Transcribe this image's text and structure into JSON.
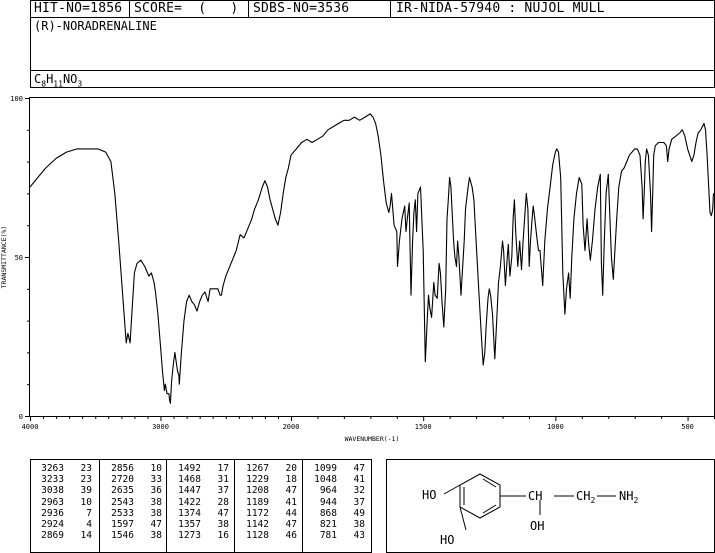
{
  "header": {
    "hit_no": "HIT-NO=1856",
    "score": "SCORE=  (   )",
    "sdbs_no": "SDBS-NO=3536",
    "ir_no": "IR-NIDA-57940 : NUJOL MULL"
  },
  "compound": {
    "name": "(R)-NORADRENALINE",
    "formula": "C8H11NO3"
  },
  "chart_data": {
    "type": "line",
    "xlabel": "WAVENUMBER(-1)",
    "ylabel": "TRANSMITTANCE(%)",
    "xlim": [
      4000,
      400
    ],
    "ylim": [
      0,
      100
    ],
    "x_ticks": [
      "4000",
      "3000",
      "2000",
      "1500",
      "1000",
      "500"
    ],
    "y_ticks": [
      "0",
      "50",
      "100"
    ],
    "grid": false,
    "series": [
      {
        "points": [
          [
            4000,
            72
          ],
          [
            3940,
            75
          ],
          [
            3880,
            78
          ],
          [
            3800,
            81
          ],
          [
            3720,
            83
          ],
          [
            3640,
            84
          ],
          [
            3560,
            84
          ],
          [
            3480,
            84
          ],
          [
            3420,
            83
          ],
          [
            3380,
            80
          ],
          [
            3350,
            70
          ],
          [
            3320,
            55
          ],
          [
            3290,
            38
          ],
          [
            3263,
            23
          ],
          [
            3250,
            26
          ],
          [
            3233,
            23
          ],
          [
            3215,
            35
          ],
          [
            3200,
            45
          ],
          [
            3180,
            48
          ],
          [
            3150,
            49
          ],
          [
            3120,
            47
          ],
          [
            3090,
            44
          ],
          [
            3070,
            45
          ],
          [
            3050,
            42
          ],
          [
            3038,
            39
          ],
          [
            3020,
            32
          ],
          [
            3000,
            22
          ],
          [
            2985,
            14
          ],
          [
            2970,
            8
          ],
          [
            2963,
            10
          ],
          [
            2950,
            7
          ],
          [
            2936,
            7
          ],
          [
            2930,
            5
          ],
          [
            2924,
            4
          ],
          [
            2915,
            11
          ],
          [
            2900,
            17
          ],
          [
            2890,
            20
          ],
          [
            2880,
            17
          ],
          [
            2869,
            14
          ],
          [
            2860,
            13
          ],
          [
            2856,
            10
          ],
          [
            2840,
            20
          ],
          [
            2820,
            30
          ],
          [
            2800,
            36
          ],
          [
            2780,
            38
          ],
          [
            2760,
            36
          ],
          [
            2740,
            35
          ],
          [
            2720,
            33
          ],
          [
            2700,
            36
          ],
          [
            2680,
            38
          ],
          [
            2660,
            39
          ],
          [
            2635,
            36
          ],
          [
            2620,
            40
          ],
          [
            2600,
            40
          ],
          [
            2580,
            40
          ],
          [
            2560,
            40
          ],
          [
            2543,
            38
          ],
          [
            2533,
            38
          ],
          [
            2520,
            41
          ],
          [
            2500,
            44
          ],
          [
            2460,
            48
          ],
          [
            2420,
            52
          ],
          [
            2390,
            57
          ],
          [
            2360,
            56
          ],
          [
            2330,
            59
          ],
          [
            2300,
            62
          ],
          [
            2280,
            65
          ],
          [
            2250,
            68
          ],
          [
            2220,
            72
          ],
          [
            2200,
            74
          ],
          [
            2180,
            72
          ],
          [
            2160,
            68
          ],
          [
            2140,
            65
          ],
          [
            2120,
            62
          ],
          [
            2100,
            60
          ],
          [
            2080,
            64
          ],
          [
            2060,
            70
          ],
          [
            2040,
            75
          ],
          [
            2020,
            78
          ],
          [
            2000,
            82
          ],
          [
            1980,
            84
          ],
          [
            1960,
            86
          ],
          [
            1940,
            87
          ],
          [
            1920,
            86
          ],
          [
            1900,
            87
          ],
          [
            1880,
            88
          ],
          [
            1860,
            90
          ],
          [
            1840,
            91
          ],
          [
            1820,
            92
          ],
          [
            1800,
            93
          ],
          [
            1780,
            93
          ],
          [
            1760,
            94
          ],
          [
            1740,
            93
          ],
          [
            1720,
            94
          ],
          [
            1700,
            95
          ],
          [
            1690,
            94
          ],
          [
            1680,
            92
          ],
          [
            1670,
            88
          ],
          [
            1660,
            82
          ],
          [
            1650,
            74
          ],
          [
            1640,
            67
          ],
          [
            1630,
            64
          ],
          [
            1625,
            66
          ],
          [
            1620,
            70
          ],
          [
            1610,
            60
          ],
          [
            1600,
            58
          ],
          [
            1597,
            47
          ],
          [
            1590,
            55
          ],
          [
            1580,
            62
          ],
          [
            1570,
            66
          ],
          [
            1565,
            58
          ],
          [
            1560,
            62
          ],
          [
            1553,
            67
          ],
          [
            1546,
            38
          ],
          [
            1540,
            55
          ],
          [
            1535,
            64
          ],
          [
            1530,
            68
          ],
          [
            1525,
            58
          ],
          [
            1520,
            70
          ],
          [
            1510,
            72
          ],
          [
            1500,
            52
          ],
          [
            1492,
            17
          ],
          [
            1485,
            30
          ],
          [
            1480,
            38
          ],
          [
            1475,
            34
          ],
          [
            1468,
            31
          ],
          [
            1460,
            42
          ],
          [
            1455,
            38
          ],
          [
            1447,
            37
          ],
          [
            1440,
            48
          ],
          [
            1435,
            45
          ],
          [
            1428,
            35
          ],
          [
            1422,
            28
          ],
          [
            1415,
            40
          ],
          [
            1410,
            62
          ],
          [
            1405,
            68
          ],
          [
            1400,
            75
          ],
          [
            1395,
            72
          ],
          [
            1385,
            55
          ],
          [
            1380,
            50
          ],
          [
            1374,
            47
          ],
          [
            1370,
            55
          ],
          [
            1365,
            50
          ],
          [
            1357,
            38
          ],
          [
            1352,
            45
          ],
          [
            1345,
            55
          ],
          [
            1340,
            65
          ],
          [
            1330,
            72
          ],
          [
            1325,
            75
          ],
          [
            1315,
            72
          ],
          [
            1308,
            68
          ],
          [
            1300,
            55
          ],
          [
            1290,
            40
          ],
          [
            1280,
            25
          ],
          [
            1273,
            16
          ],
          [
            1267,
            20
          ],
          [
            1262,
            28
          ],
          [
            1255,
            37
          ],
          [
            1250,
            40
          ],
          [
            1245,
            38
          ],
          [
            1238,
            32
          ],
          [
            1229,
            18
          ],
          [
            1222,
            30
          ],
          [
            1215,
            42
          ],
          [
            1208,
            47
          ],
          [
            1200,
            55
          ],
          [
            1196,
            52
          ],
          [
            1189,
            41
          ],
          [
            1182,
            50
          ],
          [
            1178,
            54
          ],
          [
            1172,
            44
          ],
          [
            1165,
            50
          ],
          [
            1160,
            62
          ],
          [
            1155,
            68
          ],
          [
            1150,
            58
          ],
          [
            1142,
            47
          ],
          [
            1135,
            55
          ],
          [
            1128,
            46
          ],
          [
            1122,
            55
          ],
          [
            1115,
            64
          ],
          [
            1110,
            70
          ],
          [
            1104,
            65
          ],
          [
            1099,
            47
          ],
          [
            1094,
            55
          ],
          [
            1088,
            62
          ],
          [
            1084,
            66
          ],
          [
            1078,
            62
          ],
          [
            1070,
            56
          ],
          [
            1064,
            52
          ],
          [
            1058,
            52
          ],
          [
            1048,
            41
          ],
          [
            1040,
            55
          ],
          [
            1030,
            65
          ],
          [
            1020,
            72
          ],
          [
            1010,
            79
          ],
          [
            1000,
            83
          ],
          [
            995,
            84
          ],
          [
            988,
            83
          ],
          [
            980,
            75
          ],
          [
            972,
            45
          ],
          [
            964,
            32
          ],
          [
            958,
            40
          ],
          [
            950,
            45
          ],
          [
            944,
            37
          ],
          [
            938,
            50
          ],
          [
            930,
            62
          ],
          [
            920,
            70
          ],
          [
            910,
            75
          ],
          [
            900,
            73
          ],
          [
            895,
            60
          ],
          [
            888,
            52
          ],
          [
            880,
            62
          ],
          [
            875,
            55
          ],
          [
            868,
            49
          ],
          [
            860,
            55
          ],
          [
            850,
            65
          ],
          [
            840,
            72
          ],
          [
            830,
            76
          ],
          [
            826,
            48
          ],
          [
            821,
            38
          ],
          [
            815,
            55
          ],
          [
            808,
            70
          ],
          [
            800,
            76
          ],
          [
            795,
            65
          ],
          [
            788,
            50
          ],
          [
            781,
            43
          ],
          [
            775,
            52
          ],
          [
            768,
            62
          ],
          [
            760,
            72
          ],
          [
            750,
            77
          ],
          [
            740,
            78
          ],
          [
            730,
            80
          ],
          [
            720,
            82
          ],
          [
            710,
            83
          ],
          [
            700,
            84
          ],
          [
            690,
            84
          ],
          [
            680,
            82
          ],
          [
            672,
            72
          ],
          [
            668,
            62
          ],
          [
            664,
            70
          ],
          [
            660,
            80
          ],
          [
            655,
            84
          ],
          [
            648,
            82
          ],
          [
            640,
            70
          ],
          [
            636,
            58
          ],
          [
            632,
            70
          ],
          [
            628,
            82
          ],
          [
            622,
            85
          ],
          [
            610,
            86
          ],
          [
            600,
            86
          ],
          [
            590,
            86
          ],
          [
            580,
            85
          ],
          [
            575,
            80
          ],
          [
            570,
            84
          ],
          [
            560,
            87
          ],
          [
            545,
            88
          ],
          [
            530,
            89
          ],
          [
            520,
            90
          ],
          [
            510,
            88
          ],
          [
            500,
            84
          ],
          [
            492,
            82
          ],
          [
            484,
            80
          ],
          [
            476,
            82
          ],
          [
            468,
            86
          ],
          [
            460,
            89
          ],
          [
            450,
            90
          ],
          [
            444,
            91
          ],
          [
            438,
            92
          ],
          [
            432,
            90
          ],
          [
            426,
            82
          ],
          [
            420,
            72
          ],
          [
            415,
            64
          ],
          [
            410,
            63
          ],
          [
            405,
            65
          ],
          [
            402,
            70
          ]
        ]
      }
    ]
  },
  "peaks": [
    [
      "3263",
      "23"
    ],
    [
      "3233",
      "23"
    ],
    [
      "3038",
      "39"
    ],
    [
      "2963",
      "10"
    ],
    [
      "2936",
      "7"
    ],
    [
      "2924",
      "4"
    ],
    [
      "2869",
      "14"
    ],
    [
      "2856",
      "10"
    ],
    [
      "2720",
      "33"
    ],
    [
      "2635",
      "36"
    ],
    [
      "2543",
      "38"
    ],
    [
      "2533",
      "38"
    ],
    [
      "1597",
      "47"
    ],
    [
      "1546",
      "38"
    ],
    [
      "1492",
      "17"
    ],
    [
      "1468",
      "31"
    ],
    [
      "1447",
      "37"
    ],
    [
      "1422",
      "28"
    ],
    [
      "1374",
      "47"
    ],
    [
      "1357",
      "38"
    ],
    [
      "1273",
      "16"
    ],
    [
      "1267",
      "20"
    ],
    [
      "1229",
      "18"
    ],
    [
      "1208",
      "47"
    ],
    [
      "1189",
      "41"
    ],
    [
      "1172",
      "44"
    ],
    [
      "1142",
      "47"
    ],
    [
      "1128",
      "46"
    ],
    [
      "1099",
      "47"
    ],
    [
      "1048",
      "41"
    ],
    [
      "964",
      "32"
    ],
    [
      "944",
      "37"
    ],
    [
      "868",
      "49"
    ],
    [
      "821",
      "38"
    ],
    [
      "781",
      "43"
    ]
  ],
  "structure": {
    "label_ho_top": "HO",
    "label_ho_bottom": "HO",
    "label_ch": "CH",
    "label_ch2": "CH",
    "label_nh2": "NH",
    "label_oh": "OH"
  }
}
